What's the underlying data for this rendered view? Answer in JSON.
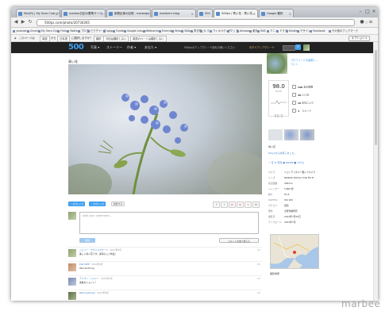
{
  "browser": {
    "tabs": [
      {
        "label": "Mixi(R) | My Gero Club (ジオロ..."
      },
      {
        "label": "marbee日記の蓄積サーバ..."
      },
      {
        "label": "新着記事の記録 - marbee's..."
      },
      {
        "label": "marbee's blog"
      },
      {
        "label": "500"
      },
      {
        "label": "500px / 青い花 - 青い花..."
      },
      {
        "label": "Google 翻訳"
      }
    ],
    "url": "500px.com/photo/20730265",
    "bookmarks": [
      "youtube",
      "Gmail",
      "My Gero Club",
      "Flickr",
      "Twitter",
      "ブログ",
      "ピクチャーズ",
      "ugiga",
      "Tumblr",
      "Google Lesson",
      "Webservice",
      "Evernote",
      "Yahoo!",
      "500px",
      "書き物",
      "カ-マ",
      "ウィキペディア",
      "マップ",
      "Amazon",
      "楽天",
      "SNS",
      "アニメ",
      "ドラマ",
      "Kindle",
      "デザイン",
      "Facebook",
      "その他のブックマーク"
    ],
    "ff_bar": {
      "items": [
        "このページは",
        "英語",
        "から",
        "日本語",
        "に翻訳しますか？",
        "翻訳",
        "今回は翻訳しない",
        "英語のページは翻訳しない"
      ],
      "options": "オプション ▾"
    }
  },
  "site": {
    "logo": "500",
    "nav": [
      "写真 ▾",
      "ストーリー",
      "作者 ▾",
      "あなた ▾"
    ],
    "header_note": "500pxのアップグレード版をお使いください",
    "upgrade_link": "今すぐアップグレード",
    "page_title": "青い花",
    "photo_buttons": {
      "like": "♡ お気に入り",
      "favorite": "☆ お気に入り",
      "report": "報告する",
      "share": [
        "f",
        "t",
        "p",
        "g",
        "s",
        "m"
      ]
    },
    "comment_placeholder": "Add your comment...",
    "post_label": "投稿",
    "sort_label": "コメントを並べ替える",
    "comments": [
      {
        "name": "ジェリー・ウヴァルルサード",
        "date": "2012年8月",
        "text": "美しい青い花です。素晴らしい作品！",
        "num": "#1"
      },
      {
        "name": "ELK PIXIE",
        "date": "2012年8月",
        "text": "Wonderful bg",
        "num": "#2"
      },
      {
        "name": "アリサン・シルドー",
        "date": "2012年8月",
        "text": "素敵なショット！",
        "num": "#3"
      },
      {
        "name": "Pablo Jaberger",
        "date": "2012年8月",
        "text": "",
        "num": "#4"
      }
    ]
  },
  "sidebar": {
    "author_label": "プロフィールを編集し...",
    "author_sub": "ていく",
    "pulse_value": "98.0",
    "pulse_label": "PULSE",
    "pulse_prev": "96.0",
    "stats": [
      {
        "icon": "eye-icon",
        "value": "198",
        "label": "表示回数"
      },
      {
        "icon": "heart-icon",
        "value": "30",
        "label": "いいね"
      },
      {
        "icon": "star-icon",
        "value": "10",
        "label": "お気に入り"
      },
      {
        "icon": "comment-icon",
        "value": "4",
        "label": "コメント"
      }
    ],
    "description": "青い花",
    "location_label": "Tokyoから共有しました。",
    "tags": "☆ 花  ★ 写真  ● NIKON  ■ マクロ",
    "exif": [
      {
        "label": "カメラ",
        "value": "ニコンデジタル一眼レフカメラ"
      },
      {
        "label": "レンズ",
        "value": "NIKKOR 300mm f/4D ED-IF"
      },
      {
        "label": "焦点距離",
        "value": "300mm"
      },
      {
        "label": "シャッター",
        "value": "1/800 秒"
      },
      {
        "label": "絞り",
        "value": "f/5.6"
      },
      {
        "label": "ISO/Film",
        "value": "ISO 200"
      },
      {
        "label": "カテゴリ",
        "value": "自然"
      },
      {
        "label": "著作",
        "value": "全著作権所有"
      },
      {
        "label": "撮影日",
        "value": "2012年7月25日"
      },
      {
        "label": "アップロード",
        "value": "2012年7月"
      }
    ],
    "map_label": "撮影場所"
  },
  "watermark": "marbee"
}
